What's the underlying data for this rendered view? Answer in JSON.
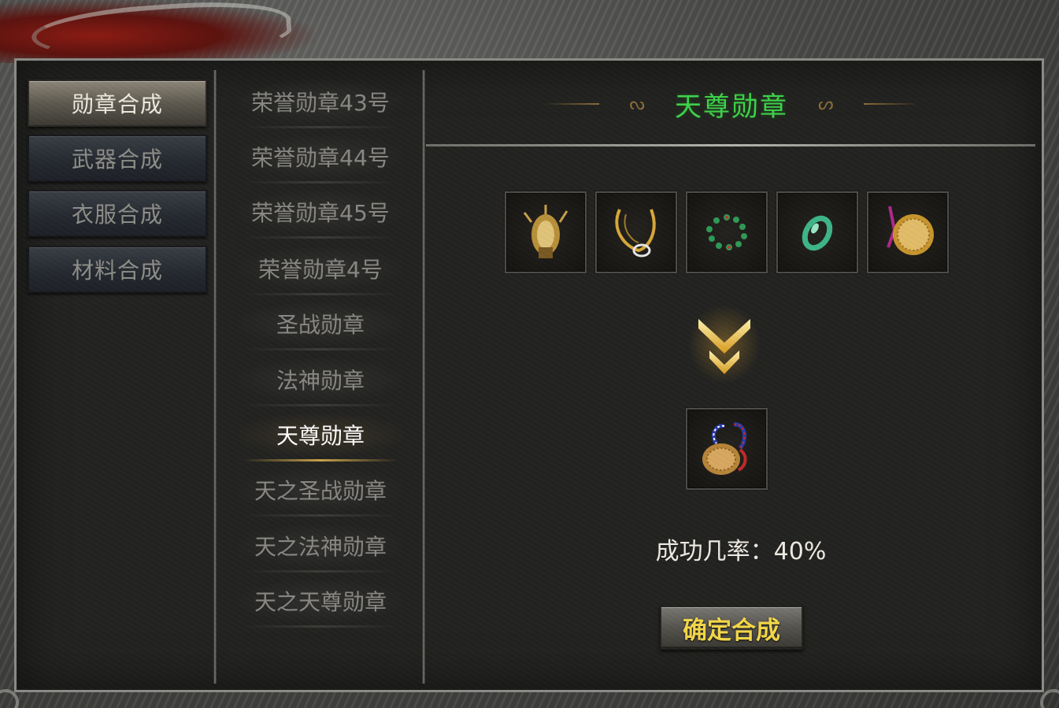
{
  "categories": [
    {
      "label": "勋章合成",
      "active": true
    },
    {
      "label": "武器合成",
      "active": false
    },
    {
      "label": "衣服合成",
      "active": false
    },
    {
      "label": "材料合成",
      "active": false
    }
  ],
  "medal_list": [
    {
      "label": "荣誉勋章43号",
      "active": false
    },
    {
      "label": "荣誉勋章44号",
      "active": false
    },
    {
      "label": "荣誉勋章45号",
      "active": false
    },
    {
      "label": "荣誉勋章4号",
      "active": false
    },
    {
      "label": "圣战勋章",
      "active": false
    },
    {
      "label": "法神勋章",
      "active": false
    },
    {
      "label": "天尊勋章",
      "active": true
    },
    {
      "label": "天之圣战勋章",
      "active": false
    },
    {
      "label": "天之法神勋章",
      "active": false
    },
    {
      "label": "天之天尊勋章",
      "active": false
    }
  ],
  "detail": {
    "title": "天尊勋章",
    "materials": [
      {
        "icon": "gold-armor-item-icon"
      },
      {
        "icon": "gold-necklace-item-icon"
      },
      {
        "icon": "jade-bead-bracelet-item-icon"
      },
      {
        "icon": "jade-ring-item-icon"
      },
      {
        "icon": "gold-medallion-item-icon"
      }
    ],
    "result_icon": "medal-result-item-icon",
    "success_rate_text": "成功几率：40%",
    "confirm_label": "确定合成"
  },
  "colors": {
    "title_green": "#3ed34a",
    "confirm_yellow": "#f4d84a",
    "arrow_gold": "#e8b838"
  }
}
